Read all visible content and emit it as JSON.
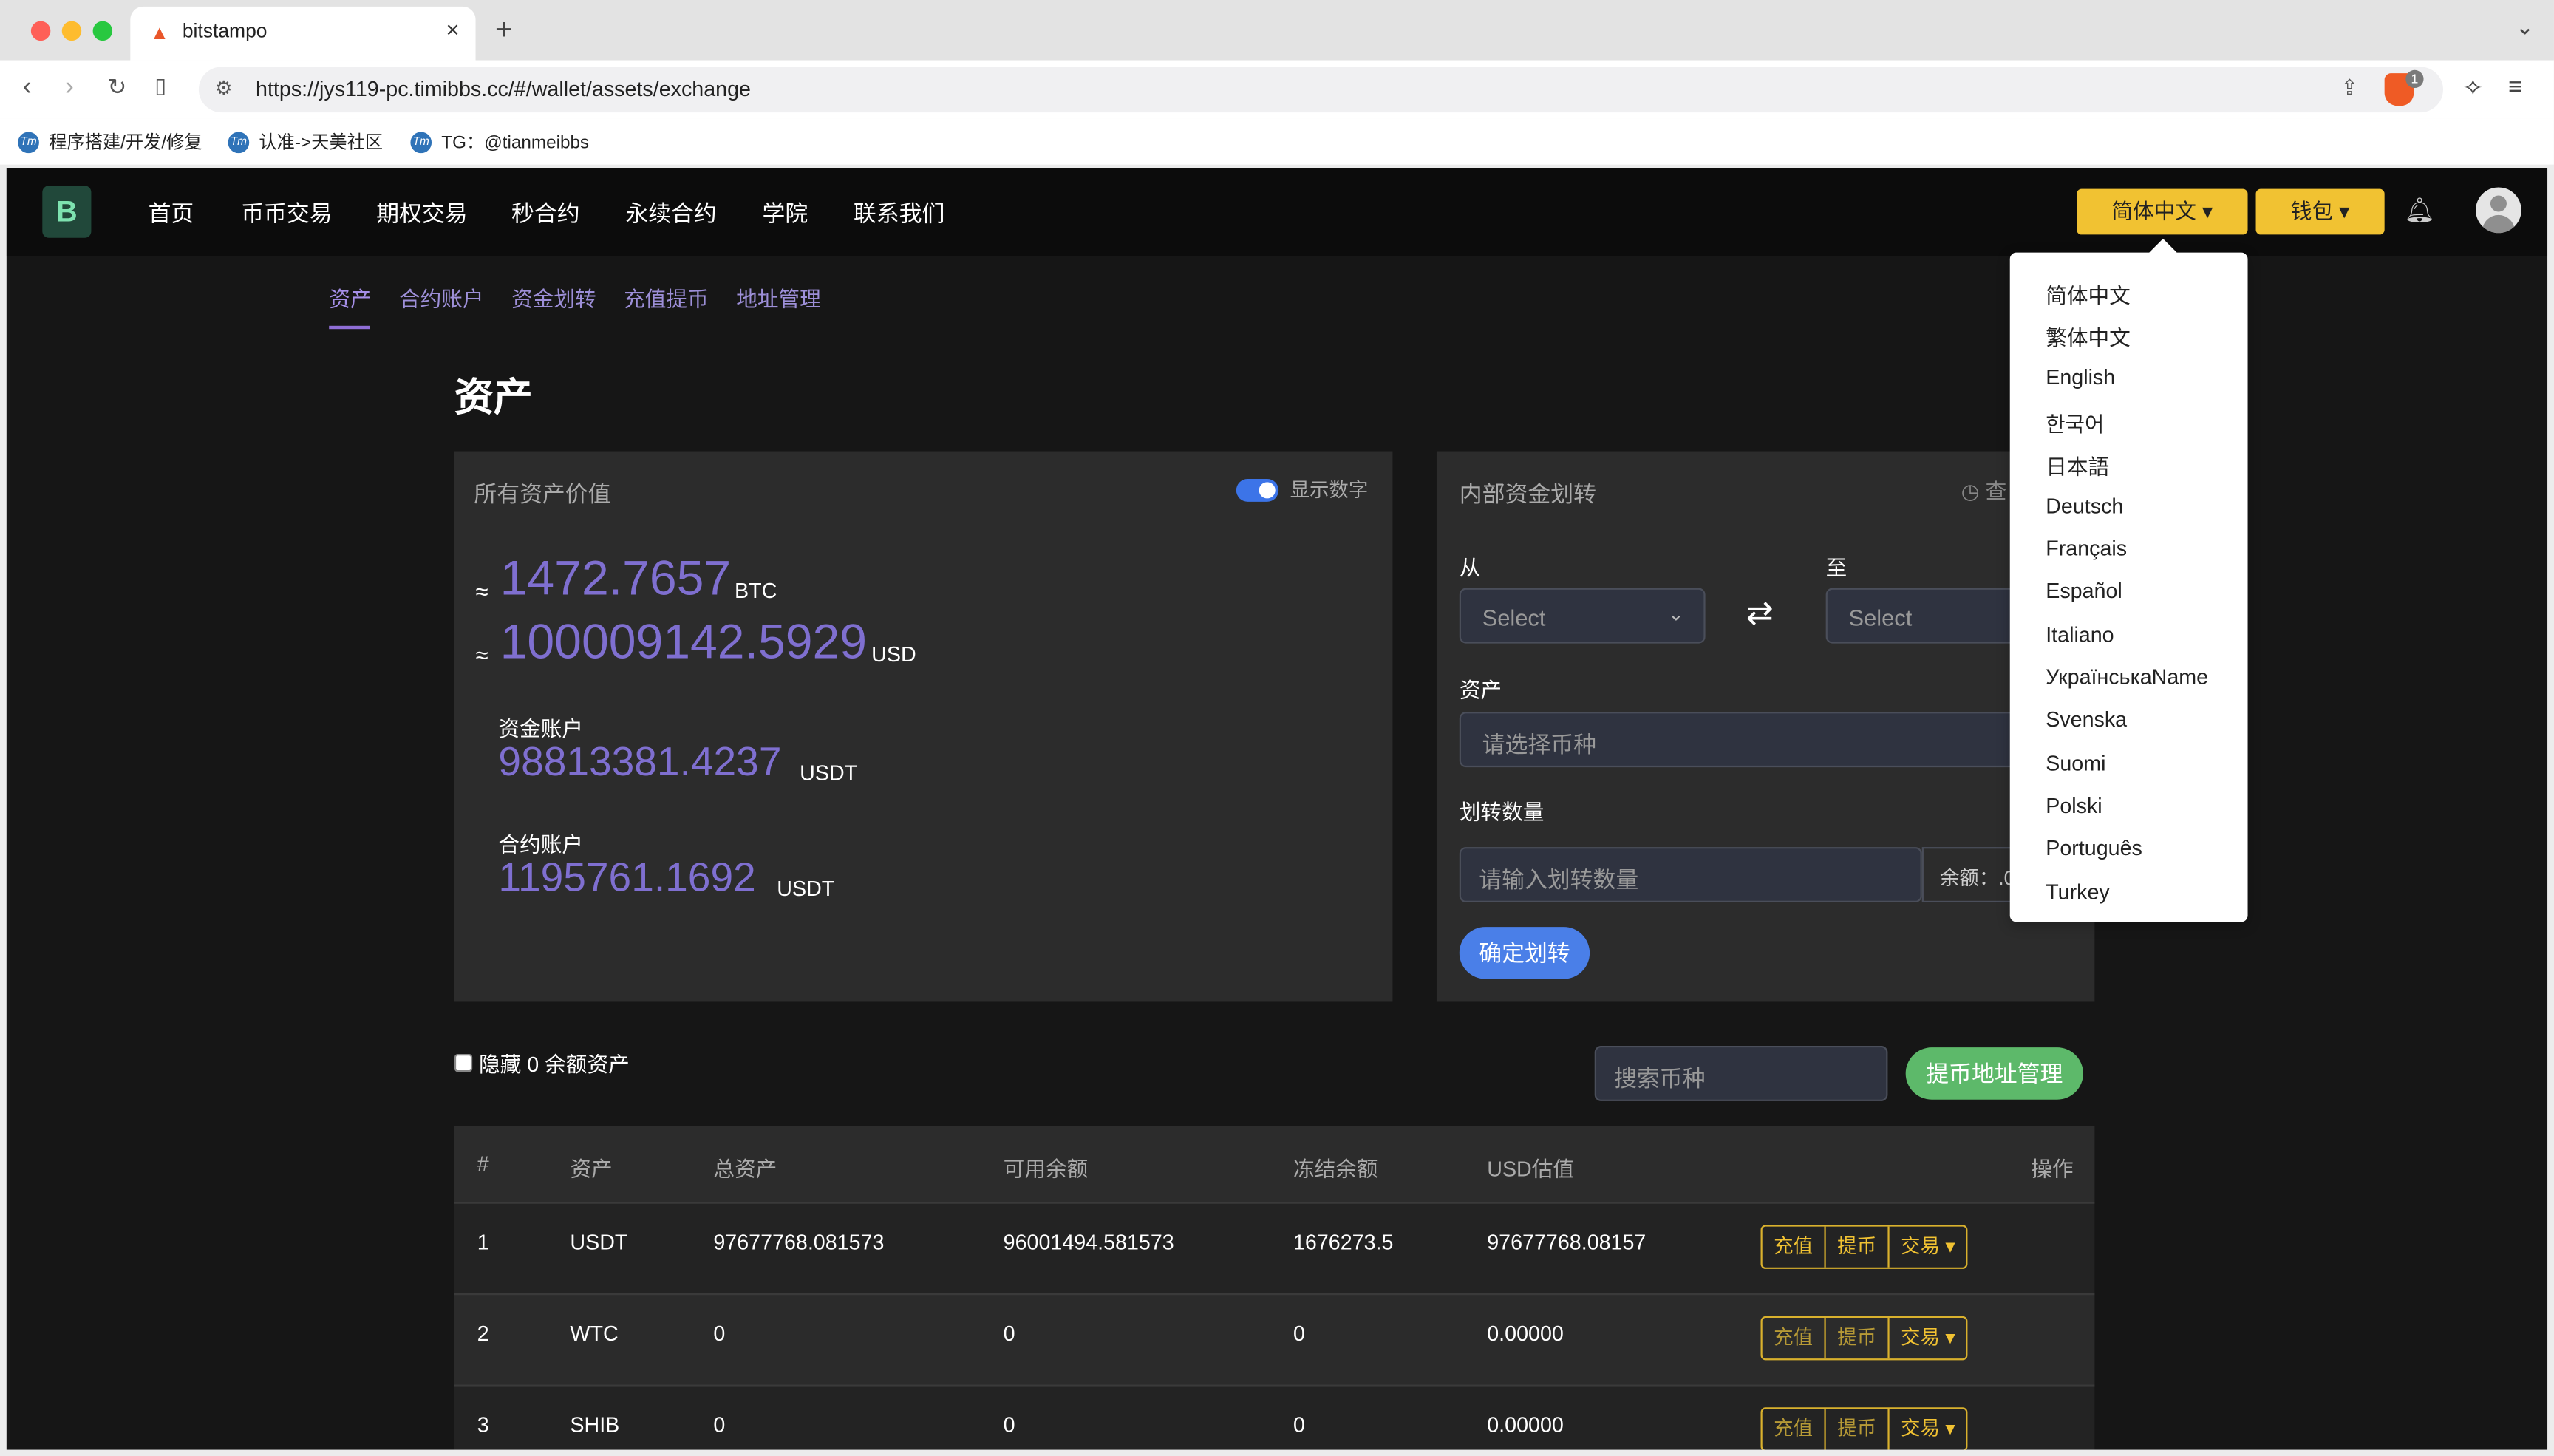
{
  "browser": {
    "tab_title": "bitstampo",
    "url": "https://jys119-pc.timibbs.cc/#/wallet/assets/exchange",
    "bookmarks": [
      "程序搭建/开发/修复",
      "认准->天美社区",
      "TG：@tianmeibbs"
    ],
    "shield_badge": "1"
  },
  "nav": {
    "logo": "B",
    "items": [
      "首页",
      "币币交易",
      "期权交易",
      "秒合约",
      "永续合约",
      "学院",
      "联系我们"
    ],
    "language_btn": "简体中文",
    "wallet_btn": "钱包"
  },
  "subnav": {
    "items": [
      "资产",
      "合约账户",
      "资金划转",
      "充值提币",
      "地址管理"
    ]
  },
  "page_title": "资产",
  "assets_card": {
    "title": "所有资产价值",
    "toggle_label": "显示数字",
    "approx": "≈",
    "btc_value": "1472.7657",
    "btc_unit": "BTC",
    "usd_value": "100009142.5929",
    "usd_unit": "USD",
    "fund_label": "资金账户",
    "fund_value": "98813381.4237",
    "fund_unit": "USDT",
    "contract_label": "合约账户",
    "contract_value": "1195761.1692",
    "contract_unit": "USDT"
  },
  "transfer_card": {
    "title": "内部资金划转",
    "history_icon_text": "查",
    "from_label": "从",
    "to_label": "至",
    "from_placeholder": "Select",
    "to_placeholder": "Select",
    "asset_label": "资产",
    "asset_placeholder": "请选择币种",
    "amount_label": "划转数量",
    "amount_placeholder": "请输入划转数量",
    "balance_label": "余额：.0",
    "confirm_btn": "确定划转"
  },
  "filters": {
    "hide_zero_label": "隐藏 0 余额资产",
    "search_placeholder": "搜索币种",
    "address_btn": "提币地址管理"
  },
  "table": {
    "headers": [
      "#",
      "资产",
      "总资产",
      "可用余额",
      "冻结余额",
      "USD估值",
      "操作"
    ],
    "rows": [
      {
        "idx": "1",
        "asset": "USDT",
        "total": "97677768.081573",
        "available": "96001494.581573",
        "frozen": "1676273.5",
        "usd": "97677768.08157"
      },
      {
        "idx": "2",
        "asset": "WTC",
        "total": "0",
        "available": "0",
        "frozen": "0",
        "usd": "0.00000"
      },
      {
        "idx": "3",
        "asset": "SHIB",
        "total": "0",
        "available": "0",
        "frozen": "0",
        "usd": "0.00000"
      }
    ],
    "op_deposit": "充值",
    "op_withdraw": "提币",
    "op_trade": "交易"
  },
  "languages": [
    "简体中文",
    "繁体中文",
    "English",
    "한국어",
    "日本語",
    "Deutsch",
    "Français",
    "Español",
    "Italiano",
    "УкраїнськаName",
    "Svenska",
    "Suomi",
    "Polski",
    "Português",
    "Turkey"
  ],
  "colors": {
    "accent_purple": "#7f6fd0",
    "nav_yellow": "#f1c232",
    "confirm_blue": "#4a7fe8",
    "address_green": "#5db96a"
  }
}
